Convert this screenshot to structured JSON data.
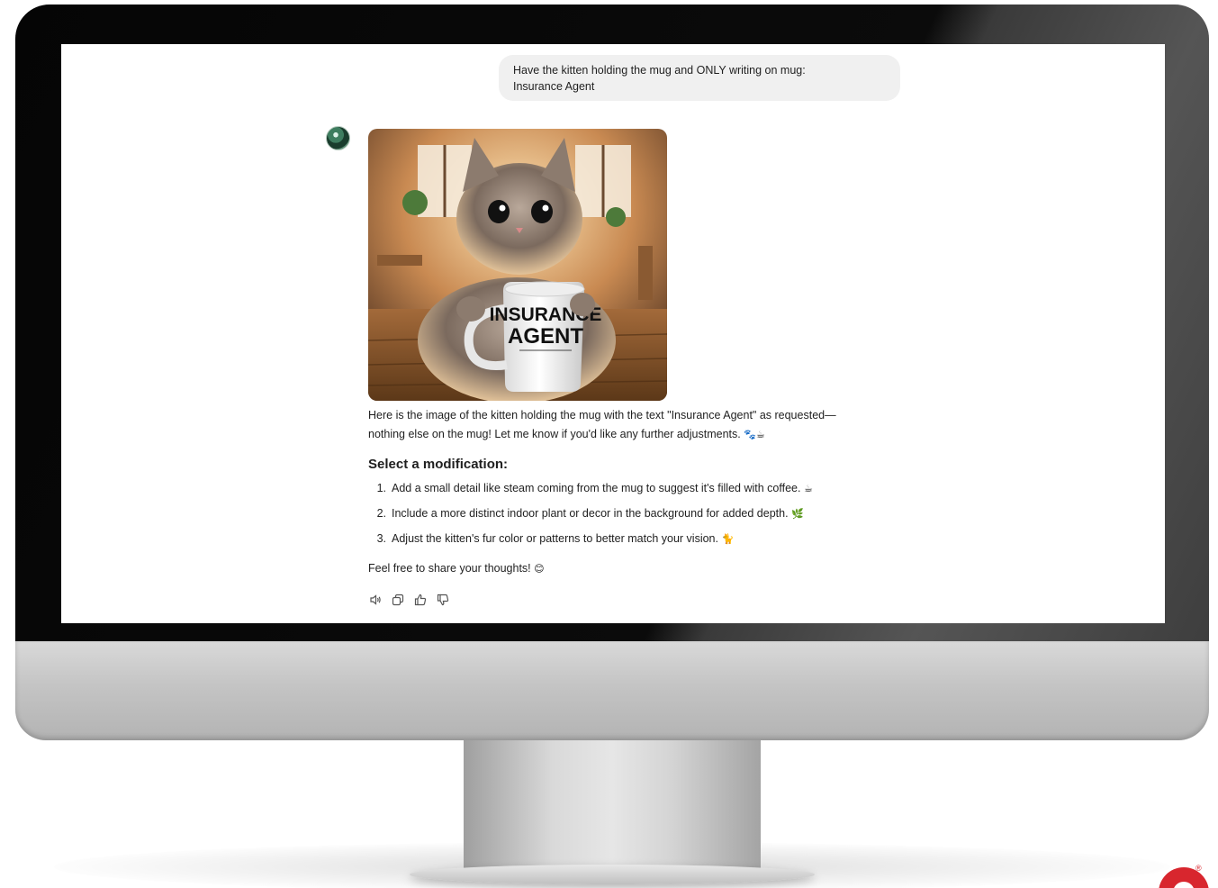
{
  "conversation": {
    "user_message": {
      "line1": "Have the kitten holding the mug and ONLY writing on mug:",
      "line2": "Insurance Agent"
    },
    "assistant": {
      "avatar_icon": "assistant-avatar-icon",
      "image": {
        "mug_text_line1": "INSURANCE",
        "mug_text_line2": "AGENT"
      },
      "body_line1": "Here is the image of the kitten holding the mug with the text \"Insurance Agent\" as requested—",
      "body_line2": "nothing else on the mug! Let me know if you'd like any further adjustments.",
      "body_emoji": "🐾☕",
      "heading": "Select a modification:",
      "options": [
        {
          "number": "1.",
          "text": "Add a small detail like steam coming from the mug to suggest it's filled with coffee.",
          "emoji": "☕"
        },
        {
          "number": "2.",
          "text": "Include a more distinct indoor plant or decor in the background for added depth.",
          "emoji": "🌿"
        },
        {
          "number": "3.",
          "text": "Adjust the kitten's fur color or patterns to better match your vision.",
          "emoji": "🐈"
        }
      ],
      "closing": "Feel free to share your thoughts!",
      "closing_emoji": "😊",
      "actions": [
        "read-aloud-icon",
        "copy-icon",
        "thumbs-up-icon",
        "thumbs-down-icon"
      ]
    }
  },
  "colors": {
    "brand_red": "#d8262e",
    "bubble": "#f0f0f0",
    "text": "#1f1f1f"
  }
}
